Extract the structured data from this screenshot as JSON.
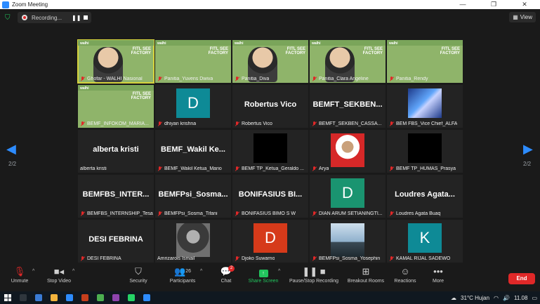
{
  "window": {
    "title": "Zoom Meeting"
  },
  "titlebar": {
    "minimize": "—",
    "restore": "❐",
    "close": "✕"
  },
  "topbar": {
    "recording_label": "Recording...",
    "view_label": "View",
    "shield_color": "#22c55e"
  },
  "pager": {
    "left_label": "2/2",
    "right_label": "2/2",
    "arrow_color": "#2d8cff"
  },
  "slide": {
    "brand": "walhi",
    "title_line1": "FITL SEE",
    "title_line2": "FACTORY"
  },
  "tiles": [
    {
      "name": "Ghofar - WALHI Nasional",
      "kind": "slide-person",
      "muted": false,
      "active": true
    },
    {
      "name": "Panitia_Yuvens Dwiva",
      "kind": "slide",
      "muted": true
    },
    {
      "name": "Panitia_Diva",
      "kind": "slide-person",
      "muted": true
    },
    {
      "name": "Panitia_Clara Angeline",
      "kind": "slide-person",
      "muted": true
    },
    {
      "name": "Panitia_Rendy",
      "kind": "slide",
      "muted": true
    },
    {
      "name": "BEMF_INFOKOM_MARIA...",
      "kind": "slide",
      "muted": true
    },
    {
      "name": "dhiyan krishna",
      "kind": "avatar",
      "letter": "D",
      "color": "#0e8a96",
      "muted": true
    },
    {
      "name": "Robertus Vico",
      "kind": "text",
      "big": "Robertus Vico",
      "muted": true
    },
    {
      "name": "BEMFT_SEKBEN_CASSA...",
      "kind": "text",
      "big": "BEMFT_SEKBEN...",
      "muted": true
    },
    {
      "name": "BEM FBS_Vice Chief_ALFA",
      "kind": "image",
      "muted": true
    },
    {
      "name": "alberta kristi",
      "kind": "text",
      "big": "alberta kristi",
      "muted": false
    },
    {
      "name": "BEMF_Wakil Ketua_Mario",
      "kind": "text",
      "big": "BEMF_Wakil Ke...",
      "muted": true
    },
    {
      "name": "BEMF TP_Ketua_Geraldo ...",
      "kind": "black",
      "muted": true
    },
    {
      "name": "Arya",
      "kind": "photo-red",
      "muted": true
    },
    {
      "name": "BEMF TP_HUMAS_Prasya",
      "kind": "black",
      "muted": true
    },
    {
      "name": "BEMFBS_INTERNSHIP_Tesa",
      "kind": "text",
      "big": "BEMFBS_INTER...",
      "muted": true
    },
    {
      "name": "BEMFPsi_Sosma_Tifani",
      "kind": "text",
      "big": "BEMFPsi_Sosma...",
      "muted": true
    },
    {
      "name": "BONIFASIUS BIMO S W",
      "kind": "text",
      "big": "BONIFASIUS BI...",
      "muted": true
    },
    {
      "name": "DIAN ARUM SETIANINGTI...",
      "kind": "avatar",
      "letter": "D",
      "color": "#1a9470",
      "muted": true
    },
    {
      "name": "Loudres Agata Buaq",
      "kind": "text",
      "big": "Loudres Agata...",
      "muted": true
    },
    {
      "name": "DESI FEBRINA",
      "kind": "text",
      "big": "DESI FEBRINA",
      "muted": true
    },
    {
      "name": "Amrizarois Ismail",
      "kind": "photo-bw",
      "muted": false
    },
    {
      "name": "Djoko Suwarno",
      "kind": "avatar",
      "letter": "D",
      "color": "#d63a1a",
      "muted": true
    },
    {
      "name": "BEMFPsi_Sosma_Yosephin",
      "kind": "photo-sky",
      "muted": true
    },
    {
      "name": "KAMAL RIJAL SADEWO",
      "kind": "avatar",
      "letter": "K",
      "color": "#0e8a96",
      "muted": true
    }
  ],
  "toolbar": {
    "unmute": "Unmute",
    "stop_video": "Stop Video",
    "security": "Security",
    "participants": "Participants",
    "participants_count": "26",
    "chat": "Chat",
    "chat_badge": "2",
    "share_screen": "Share Screen",
    "pause_stop_recording": "Pause/Stop Recording",
    "breakout_rooms": "Breakout Rooms",
    "reactions": "Reactions",
    "more": "More",
    "end": "End"
  },
  "taskbar": {
    "weather": "31°C Hujan",
    "time": "11.08"
  }
}
